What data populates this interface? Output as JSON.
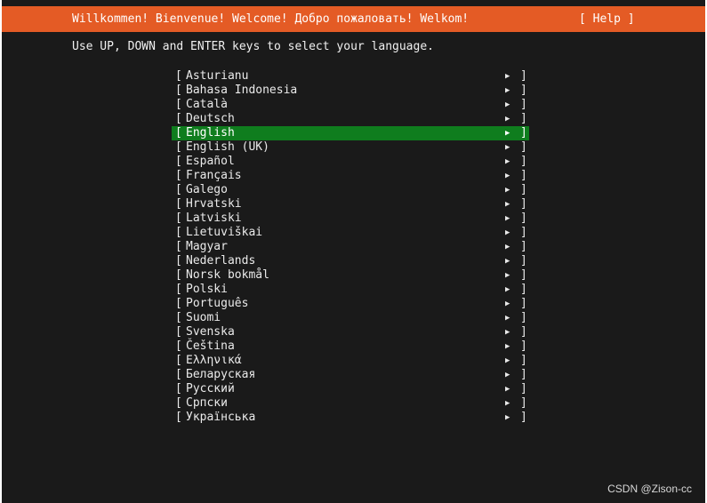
{
  "header": {
    "title": "Willkommen! Bienvenue! Welcome! Добро пожаловать! Welkom!",
    "help_label": "[ Help ]"
  },
  "instruction": "Use UP, DOWN and ENTER keys to select your language.",
  "languages": {
    "left_bracket": "[",
    "right_bracket": "]",
    "arrow": "▶",
    "selected": "English",
    "items": [
      {
        "label": "Asturianu"
      },
      {
        "label": "Bahasa Indonesia"
      },
      {
        "label": "Català"
      },
      {
        "label": "Deutsch"
      },
      {
        "label": "English"
      },
      {
        "label": "English (UK)"
      },
      {
        "label": "Español"
      },
      {
        "label": "Français"
      },
      {
        "label": "Galego"
      },
      {
        "label": "Hrvatski"
      },
      {
        "label": "Latviski"
      },
      {
        "label": "Lietuviškai"
      },
      {
        "label": "Magyar"
      },
      {
        "label": "Nederlands"
      },
      {
        "label": "Norsk bokmål"
      },
      {
        "label": "Polski"
      },
      {
        "label": "Português"
      },
      {
        "label": "Suomi"
      },
      {
        "label": "Svenska"
      },
      {
        "label": "Čeština"
      },
      {
        "label": "Ελληνικά"
      },
      {
        "label": "Беларуская"
      },
      {
        "label": "Русский"
      },
      {
        "label": "Српски"
      },
      {
        "label": "Українська"
      }
    ]
  },
  "watermark": "CSDN @Zison-cc",
  "colors": {
    "header_bg": "#e45b25",
    "screen_bg": "#1a1a1a",
    "selected_bg": "#0f7d1e",
    "text": "#eaeaea"
  }
}
